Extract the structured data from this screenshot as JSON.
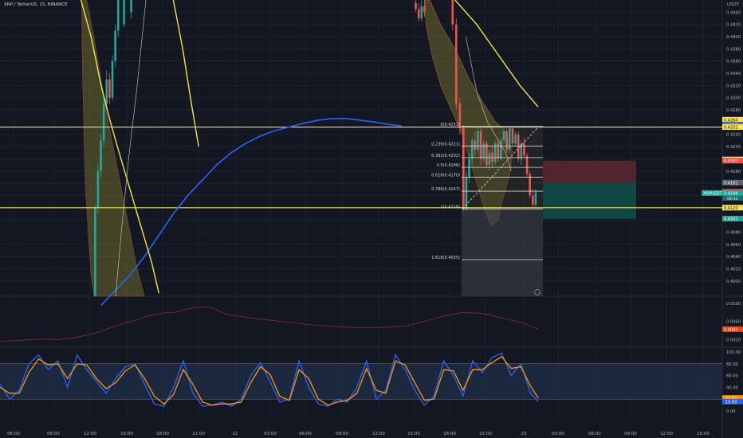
{
  "header": {
    "symbol_title": "XRP / TetherUS, 15, BINANCE",
    "unit": "USDT"
  },
  "colors": {
    "background": "#131722",
    "grid": "#1e222d",
    "up": "#26a69a",
    "down": "#ef5350",
    "fib_line": "#d1d4dc",
    "horizontal_level": "#f7e35a",
    "ema_blue": "#2962ff",
    "kc_yellow": "#f2e34c",
    "cloud_fill": "#6b6a2b",
    "rsi_line": "#2962ff",
    "rsi_signal": "#ff9800",
    "rsi_band": "#21304a",
    "risk_zone": "#5a2630",
    "reward_zone": "#0f4a45",
    "measure_fill": "#3a3f4b",
    "osc_line": "#7a2a34"
  },
  "chart_data": [
    {
      "type": "candlestick",
      "title": "XRP / TetherUS, 15, BINANCE",
      "ylabel": "USDT",
      "ylim": [
        0.3975,
        0.446
      ],
      "yticks": [
        0.4,
        0.402,
        0.404,
        0.406,
        0.408,
        0.41,
        0.412,
        0.414,
        0.416,
        0.418,
        0.42,
        0.422,
        0.424,
        0.426,
        0.428,
        0.43,
        0.432,
        0.434,
        0.436,
        0.438,
        0.44,
        0.442,
        0.444
      ],
      "x_tick_labels": [
        "06:00",
        "09:00",
        "12:00",
        "15:00",
        "18:00",
        "21:00",
        "22",
        "03:00",
        "06:00",
        "09:00",
        "12:00",
        "15:00",
        "18:00",
        "21:00",
        "23",
        "03:00",
        "06:00",
        "09:00",
        "12:00",
        "15:00"
      ],
      "price_badges": [
        {
          "value": "0.4264",
          "color": "#f7e35a",
          "text_color": "#131722"
        },
        {
          "value": "0.4256",
          "color": "#2962ff",
          "text_color": "#ffffff"
        },
        {
          "value": "0.4253",
          "color": "#ef5350",
          "text_color": "#ffffff"
        },
        {
          "value": "0.4252",
          "color": "#f7e35a",
          "text_color": "#131722"
        },
        {
          "value": "0.4199",
          "color": "#f7e35a",
          "text_color": "#131722"
        },
        {
          "value": "0.4197",
          "color": "#ef5350",
          "text_color": "#ffffff"
        },
        {
          "value": "0.4161",
          "color": "#5d606b",
          "text_color": "#ffffff"
        },
        {
          "value": "0.4146",
          "color": "#ef5350",
          "text_color": "#ffffff"
        },
        {
          "value": "0.4144",
          "color": "#26a69a",
          "text_color": "#ffffff"
        },
        {
          "value": "0.4120",
          "color": "#f7e35a",
          "text_color": "#131722"
        },
        {
          "value": "0.4102",
          "color": "#26a69a",
          "text_color": "#ffffff"
        }
      ],
      "current_label": {
        "symbol": "XRPUSDT",
        "price": "0.4144",
        "countdown": "09:33"
      },
      "horizontal_levels": [
        0.4252,
        0.412
      ],
      "fibonacci": [
        {
          "label": "0(0.4253)",
          "ratio": 0,
          "price": 0.4253
        },
        {
          "label": "0.236(0.4221)",
          "ratio": 0.236,
          "price": 0.4221
        },
        {
          "label": "0.382(0.4202)",
          "ratio": 0.382,
          "price": 0.4202
        },
        {
          "label": "0.5(0.4186)",
          "ratio": 0.5,
          "price": 0.4186
        },
        {
          "label": "0.618(0.4170)",
          "ratio": 0.618,
          "price": 0.417
        },
        {
          "label": "0.786(0.4147)",
          "ratio": 0.786,
          "price": 0.4147
        },
        {
          "label": "1(0.4118)",
          "ratio": 1,
          "price": 0.4118
        },
        {
          "label": "1.618(0.4035)",
          "ratio": 1.618,
          "price": 0.4035
        }
      ],
      "position": {
        "entry": 0.4161,
        "stop": 0.4197,
        "target": 0.4102
      },
      "ema": [
        [
          14,
          0.396
        ],
        [
          16,
          0.3985
        ],
        [
          18,
          0.401
        ],
        [
          20,
          0.404
        ],
        [
          22,
          0.4075
        ],
        [
          24,
          0.411
        ],
        [
          26,
          0.414
        ],
        [
          28,
          0.4165
        ],
        [
          30,
          0.419
        ],
        [
          32,
          0.421
        ],
        [
          34,
          0.4225
        ],
        [
          36,
          0.4237
        ],
        [
          38,
          0.4246
        ],
        [
          40,
          0.4252
        ],
        [
          42,
          0.4258
        ],
        [
          44,
          0.4263
        ],
        [
          46,
          0.4266
        ],
        [
          48,
          0.4266
        ],
        [
          50,
          0.4263
        ],
        [
          52,
          0.426
        ],
        [
          54,
          0.4256
        ],
        [
          55.6,
          0.4254
        ]
      ],
      "band_upper": [
        [
          11.2,
          0.446
        ],
        [
          12.6,
          0.44
        ],
        [
          14,
          0.432
        ],
        [
          15.3,
          0.426
        ],
        [
          16,
          0.423
        ],
        [
          17,
          0.419
        ],
        [
          18,
          0.415
        ],
        [
          19,
          0.411
        ],
        [
          20,
          0.407
        ],
        [
          21,
          0.403
        ],
        [
          22,
          0.398
        ]
      ],
      "kc_far": [
        [
          15.5,
          0.446
        ],
        [
          16.6,
          0.436
        ],
        [
          17.8,
          0.425
        ],
        [
          19,
          0.415
        ],
        [
          20.2,
          0.405
        ],
        [
          21.2,
          0.3975
        ]
      ],
      "osc": {
        "type": "line",
        "ylim": [
          0.0003,
          0.0116
        ],
        "yticks": [
          0.002,
          0.006,
          0.01
        ],
        "current": "0.0043",
        "points": [
          [
            0,
            0.0016
          ],
          [
            2,
            0.0018
          ],
          [
            4,
            0.0021
          ],
          [
            6,
            0.002
          ],
          [
            8,
            0.0025
          ],
          [
            10,
            0.0035
          ],
          [
            12,
            0.005
          ],
          [
            13,
            0.0058
          ],
          [
            14,
            0.0062
          ],
          [
            15,
            0.007
          ],
          [
            16,
            0.0075
          ],
          [
            17,
            0.0079
          ],
          [
            18,
            0.008
          ],
          [
            19,
            0.0085
          ],
          [
            20,
            0.009
          ],
          [
            21,
            0.0093
          ],
          [
            22,
            0.009
          ],
          [
            23,
            0.008
          ],
          [
            24,
            0.0074
          ],
          [
            26,
            0.0068
          ],
          [
            28,
            0.0063
          ],
          [
            30,
            0.0058
          ],
          [
            32,
            0.0053
          ],
          [
            34,
            0.005
          ],
          [
            36,
            0.0047
          ],
          [
            38,
            0.0046
          ],
          [
            40,
            0.0047
          ],
          [
            42,
            0.005
          ],
          [
            44,
            0.006
          ],
          [
            46,
            0.0072
          ],
          [
            48,
            0.008
          ],
          [
            50,
            0.0078
          ],
          [
            52,
            0.0068
          ],
          [
            54,
            0.0058
          ],
          [
            55.8,
            0.0043
          ]
        ]
      },
      "rsi": {
        "type": "line",
        "ylim": [
          -8,
          108
        ],
        "yticks": [
          0.0,
          20.0,
          40.0,
          60.0,
          80.0,
          100.0
        ],
        "band": [
          20,
          80
        ],
        "current_values": [
          "22.02",
          "15.93"
        ],
        "series": [
          {
            "name": "",
            "color": "#2962ff",
            "values": [
              [
                0,
                45
              ],
              [
                1,
                20
              ],
              [
                2,
                35
              ],
              [
                3,
                80
              ],
              [
                4,
                95
              ],
              [
                5,
                70
              ],
              [
                6,
                85
              ],
              [
                7,
                40
              ],
              [
                8,
                95
              ],
              [
                9,
                70
              ],
              [
                10,
                50
              ],
              [
                11,
                30
              ],
              [
                12,
                55
              ],
              [
                13,
                75
              ],
              [
                14,
                80
              ],
              [
                15,
                45
              ],
              [
                16,
                12
              ],
              [
                17,
                8
              ],
              [
                18,
                40
              ],
              [
                19,
                85
              ],
              [
                20,
                30
              ],
              [
                21,
                8
              ],
              [
                22,
                10
              ],
              [
                23,
                15
              ],
              [
                24,
                8
              ],
              [
                25,
                20
              ],
              [
                26,
                60
              ],
              [
                27,
                82
              ],
              [
                28,
                50
              ],
              [
                29,
                15
              ],
              [
                30,
                20
              ],
              [
                31,
                85
              ],
              [
                32,
                40
              ],
              [
                33,
                12
              ],
              [
                34,
                8
              ],
              [
                35,
                20
              ],
              [
                36,
                15
              ],
              [
                37,
                40
              ],
              [
                38,
                85
              ],
              [
                39,
                20
              ],
              [
                40,
                35
              ],
              [
                41,
                95
              ],
              [
                42,
                70
              ],
              [
                43,
                35
              ],
              [
                44,
                10
              ],
              [
                45,
                25
              ],
              [
                46,
                85
              ],
              [
                47,
                60
              ],
              [
                48,
                25
              ],
              [
                49,
                85
              ],
              [
                50,
                65
              ],
              [
                51,
                90
              ],
              [
                52,
                98
              ],
              [
                53,
                60
              ],
              [
                54,
                80
              ],
              [
                55,
                30
              ],
              [
                55.8,
                16
              ]
            ]
          },
          {
            "name": "",
            "color": "#ff9800",
            "values": [
              [
                0,
                40
              ],
              [
                1,
                30
              ],
              [
                2,
                30
              ],
              [
                3,
                65
              ],
              [
                4,
                88
              ],
              [
                5,
                78
              ],
              [
                6,
                80
              ],
              [
                7,
                55
              ],
              [
                8,
                80
              ],
              [
                9,
                78
              ],
              [
                10,
                55
              ],
              [
                11,
                38
              ],
              [
                12,
                48
              ],
              [
                13,
                68
              ],
              [
                14,
                78
              ],
              [
                15,
                55
              ],
              [
                16,
                25
              ],
              [
                17,
                12
              ],
              [
                18,
                28
              ],
              [
                19,
                70
              ],
              [
                20,
                45
              ],
              [
                21,
                15
              ],
              [
                22,
                10
              ],
              [
                23,
                12
              ],
              [
                24,
                12
              ],
              [
                25,
                15
              ],
              [
                26,
                48
              ],
              [
                27,
                75
              ],
              [
                28,
                62
              ],
              [
                29,
                25
              ],
              [
                30,
                18
              ],
              [
                31,
                70
              ],
              [
                32,
                55
              ],
              [
                33,
                20
              ],
              [
                34,
                10
              ],
              [
                35,
                15
              ],
              [
                36,
                18
              ],
              [
                37,
                30
              ],
              [
                38,
                72
              ],
              [
                39,
                35
              ],
              [
                40,
                30
              ],
              [
                41,
                85
              ],
              [
                42,
                78
              ],
              [
                43,
                48
              ],
              [
                44,
                18
              ],
              [
                45,
                20
              ],
              [
                46,
                70
              ],
              [
                47,
                68
              ],
              [
                48,
                35
              ],
              [
                49,
                70
              ],
              [
                50,
                70
              ],
              [
                51,
                82
              ],
              [
                52,
                92
              ],
              [
                53,
                72
              ],
              [
                54,
                75
              ],
              [
                55,
                42
              ],
              [
                55.8,
                22
              ]
            ]
          }
        ]
      }
    }
  ]
}
